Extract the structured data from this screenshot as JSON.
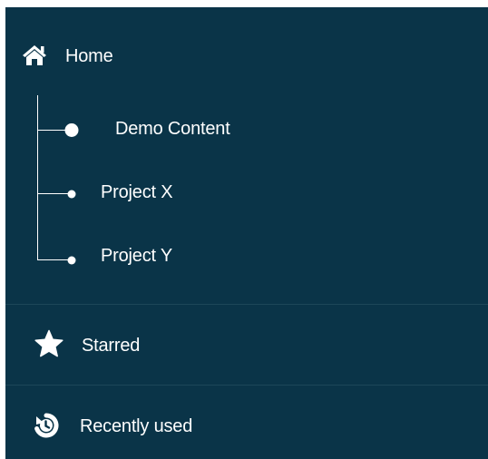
{
  "sidebar": {
    "home": {
      "label": "Home",
      "icon": "home-icon"
    },
    "children": [
      {
        "label": "Demo Content",
        "icon": "dot-bullet-large"
      },
      {
        "label": "Project X",
        "icon": "dot-bullet"
      },
      {
        "label": "Project Y",
        "icon": "dot-bullet"
      }
    ],
    "starred": {
      "label": "Starred",
      "icon": "star-icon"
    },
    "recent": {
      "label": "Recently used",
      "icon": "history-icon"
    }
  },
  "colors": {
    "background": "#0a3448",
    "text": "#ffffff",
    "divider": "#1d4759"
  }
}
